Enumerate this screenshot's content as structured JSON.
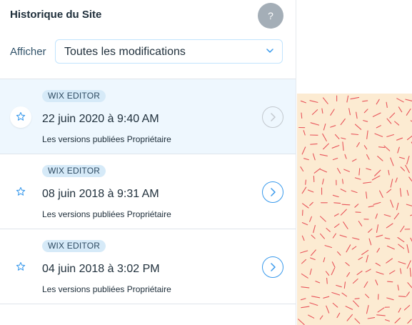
{
  "header": {
    "title": "Historique du Site",
    "help_label": "?"
  },
  "filter": {
    "label": "Afficher",
    "selected": "Toutes les modifications"
  },
  "versions": [
    {
      "badge": "WIX EDITOR",
      "date": "22 juin 2020 à 9:40 AM",
      "meta": "Les versions publiées Propriétaire",
      "selected": true
    },
    {
      "badge": "WIX EDITOR",
      "date": "08 juin 2018 à 9:31 AM",
      "meta": "Les versions publiées Propriétaire",
      "selected": false
    },
    {
      "badge": "WIX EDITOR",
      "date": "04 juin 2018 à 3:02 PM",
      "meta": "Les versions publiées Propriétaire",
      "selected": false
    }
  ],
  "icons": {
    "star": "star-icon",
    "arrow": "chevron-right-icon",
    "dropdown": "chevron-down-icon"
  },
  "colors": {
    "accent": "#3899ec",
    "selected_row": "#eef7fe",
    "badge_bg": "#d6eaf8",
    "preview_bg": "#fcebd2",
    "preview_pattern": "#e8545a"
  }
}
